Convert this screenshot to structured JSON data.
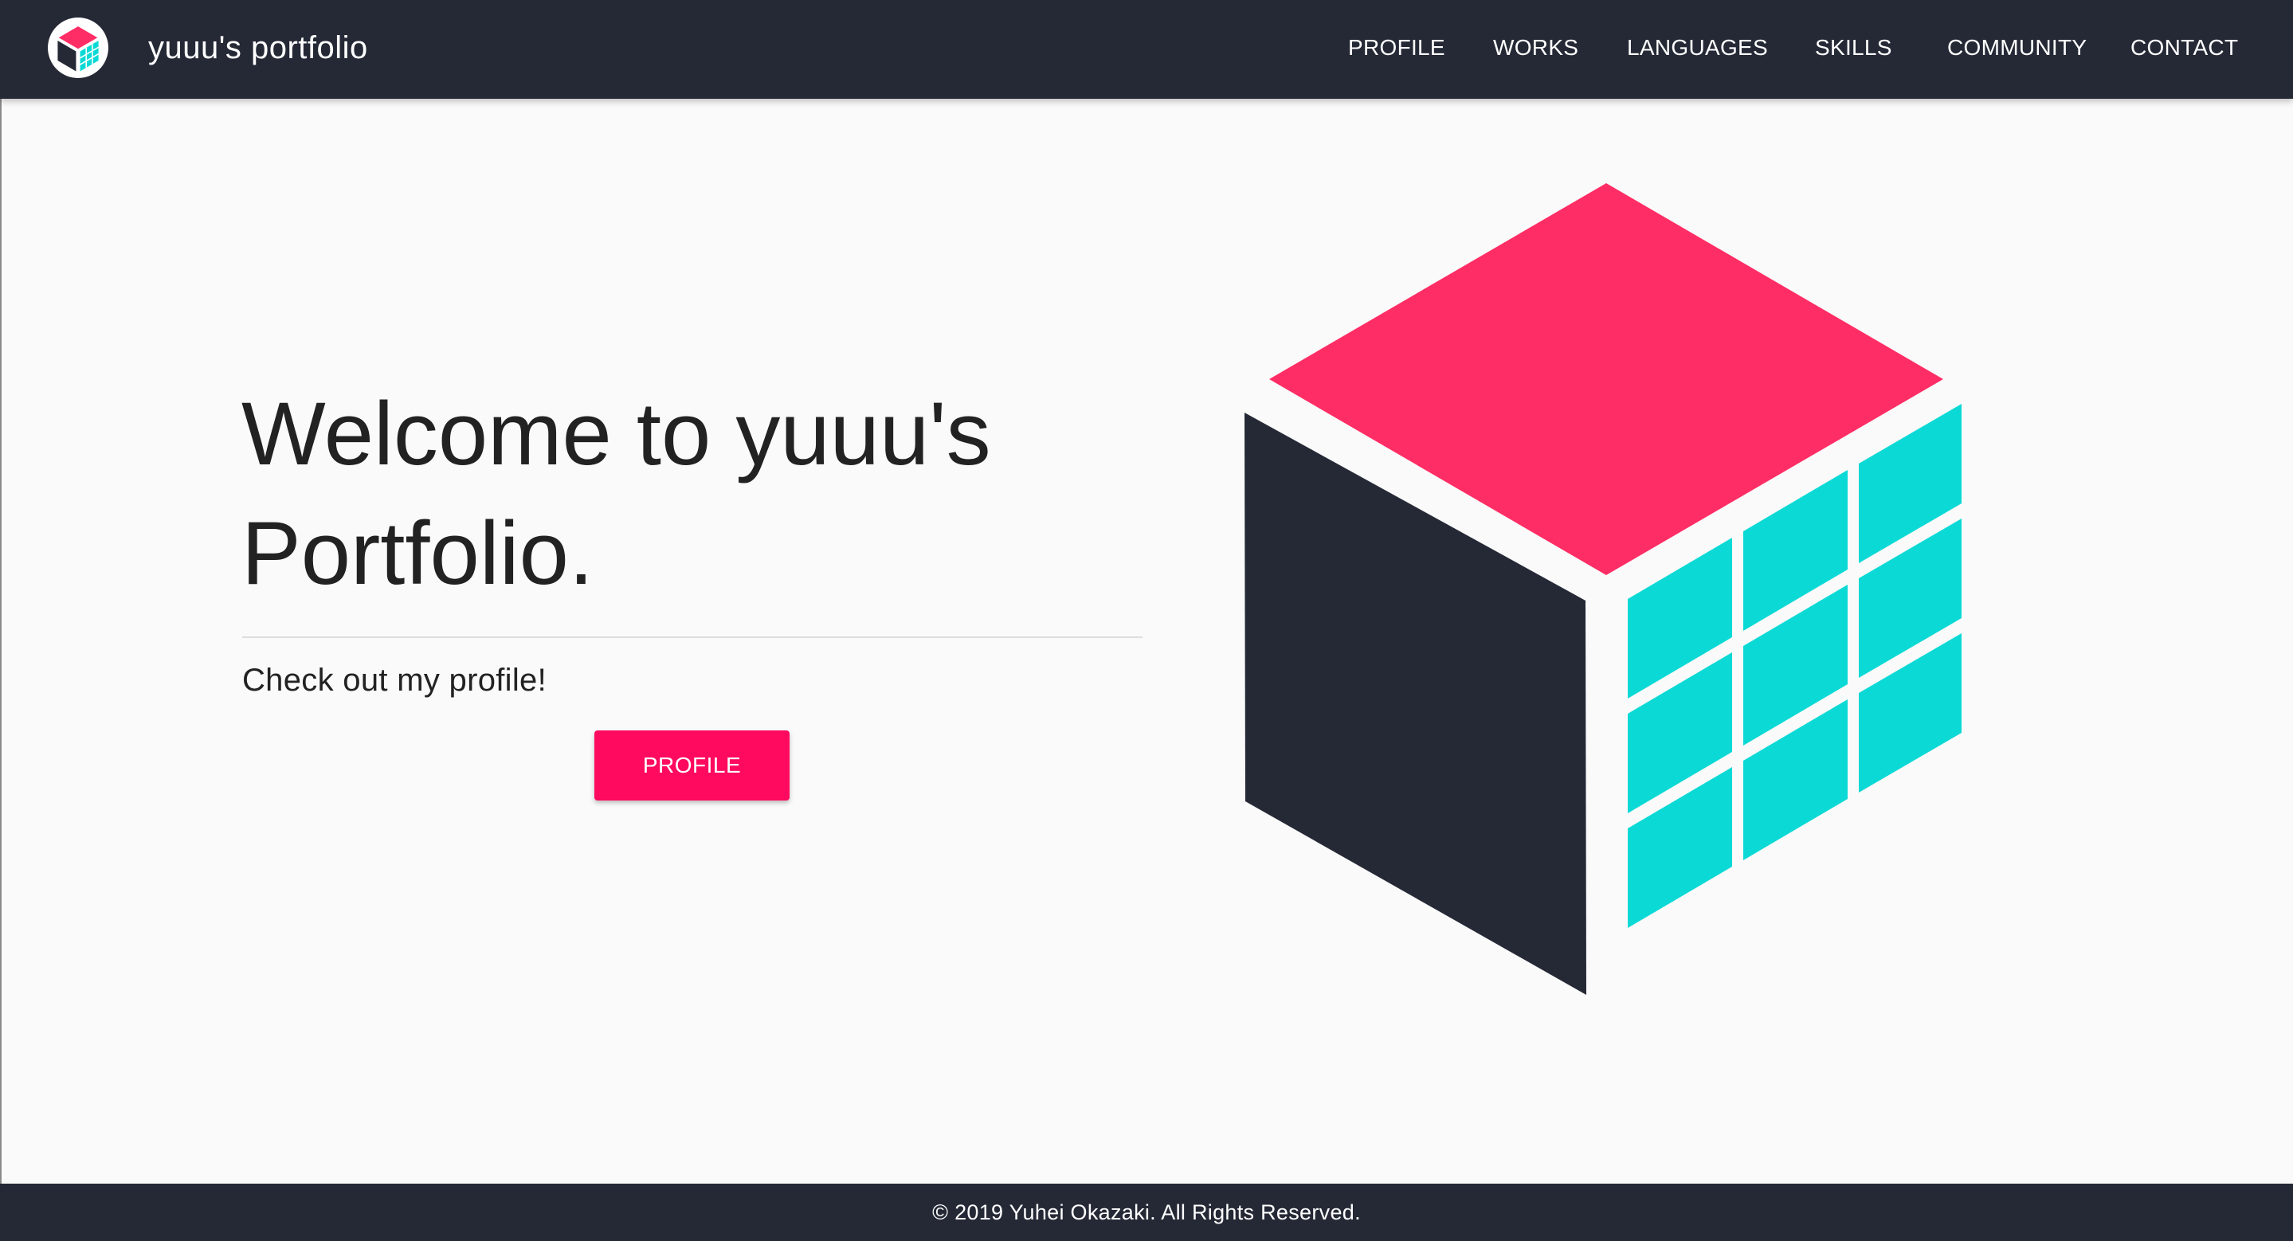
{
  "header": {
    "title": "yuuu's portfolio",
    "logo_icon": "cube-logo-icon",
    "nav": [
      {
        "label": "PROFILE"
      },
      {
        "label": "WORKS"
      },
      {
        "label": "LANGUAGES"
      },
      {
        "label": "SKILLS"
      },
      {
        "label": "COMMUNITY"
      },
      {
        "label": "CONTACT"
      }
    ]
  },
  "hero": {
    "title_line1": "Welcome to yuuu's",
    "title_line2": "Portfolio.",
    "subtitle": "Check out my profile!",
    "button_label": "PROFILE",
    "illustration_icon": "cube-illustration"
  },
  "footer": {
    "copyright": "© 2019 Yuhei Okazaki. All Rights Reserved."
  },
  "colors": {
    "header_bg": "#252936",
    "accent_pink": "#ff2d65",
    "button_pink": "#ff0a5f",
    "cube_dark": "#252936",
    "cube_teal": "#0bd9d5",
    "page_bg": "#fafafa"
  }
}
